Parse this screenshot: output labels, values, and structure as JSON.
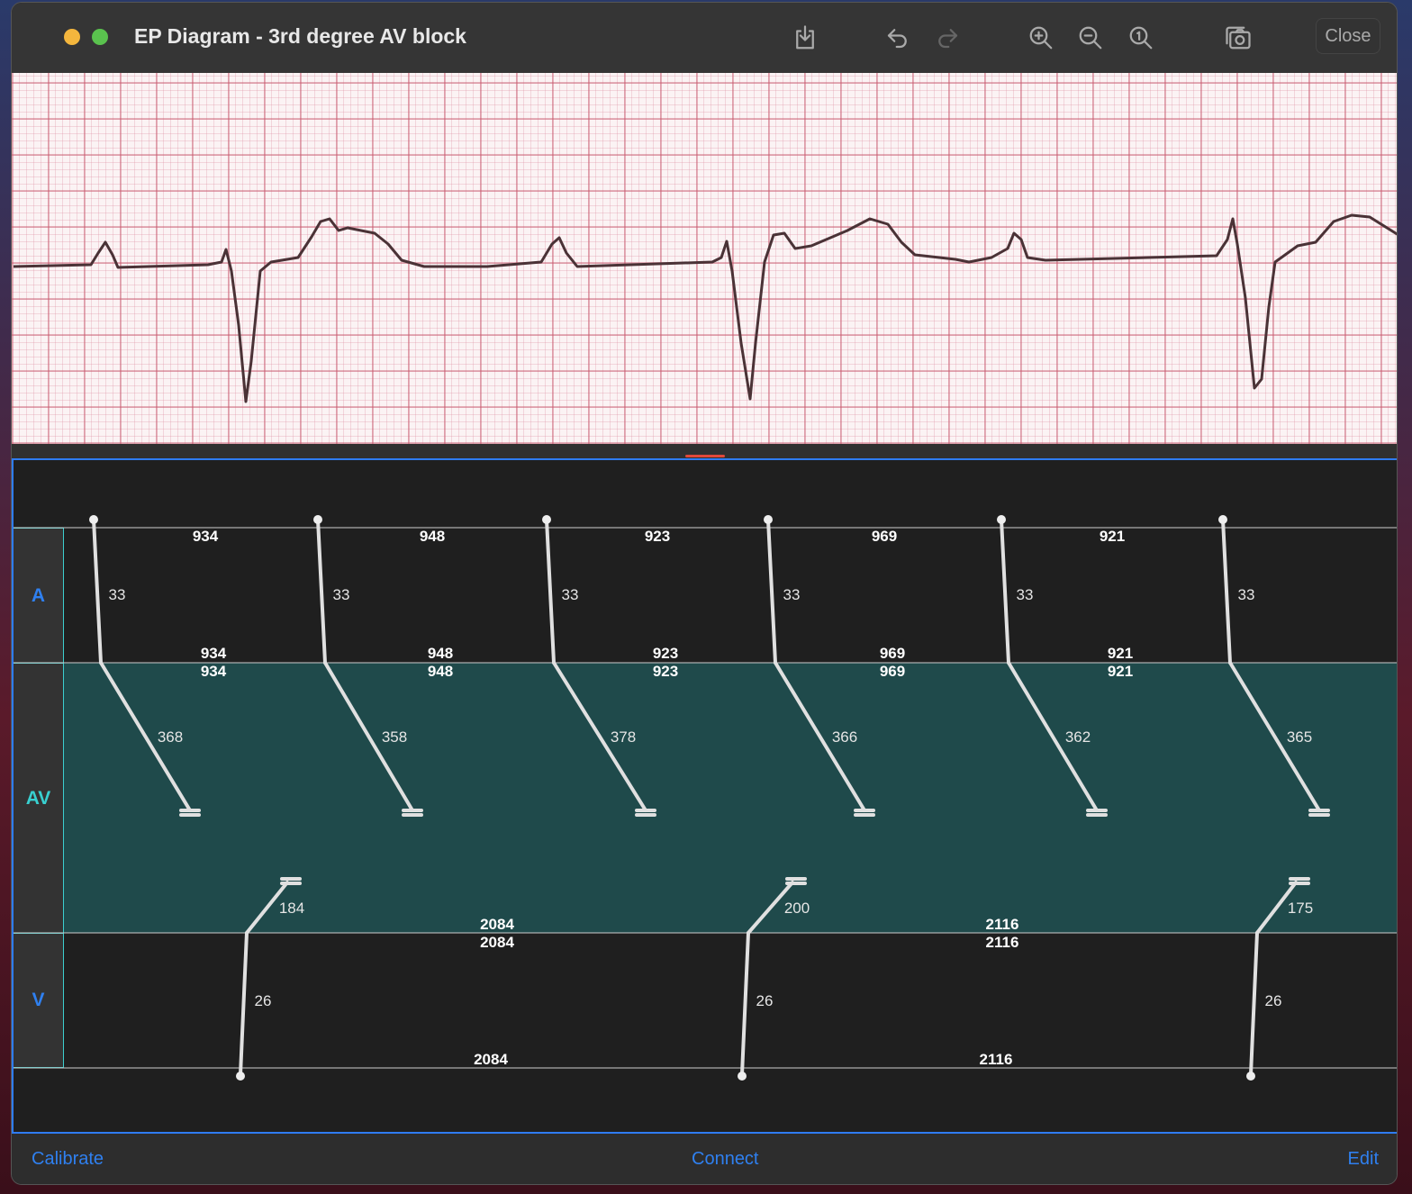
{
  "window": {
    "title": "EP Diagram - 3rd degree AV block",
    "close_label": "Close"
  },
  "toolbar": {
    "icons": [
      "share-icon",
      "undo-icon",
      "redo-icon",
      "zoom-in-icon",
      "zoom-out-icon",
      "zoom-reset-icon",
      "snapshot-icon"
    ]
  },
  "ladder": {
    "regions": [
      {
        "label": "A",
        "color": "#2f80f0"
      },
      {
        "label": "AV",
        "color": "#38d0d0"
      },
      {
        "label": "V",
        "color": "#2f80f0"
      }
    ],
    "a_cl_top": [
      "934",
      "948",
      "923",
      "969",
      "921"
    ],
    "a_cl_mid1": [
      "934",
      "948",
      "923",
      "969",
      "921"
    ],
    "a_cl_mid2": [
      "934",
      "948",
      "923",
      "969",
      "921"
    ],
    "a_cond": [
      "33",
      "33",
      "33",
      "33",
      "33",
      "33"
    ],
    "av_antegrade": [
      "368",
      "358",
      "378",
      "366",
      "362",
      "365"
    ],
    "av_retro": [
      "184",
      "200",
      "175"
    ],
    "v_cond": [
      "26",
      "26",
      "26"
    ],
    "v_cl_top1": [
      "2084",
      "2116"
    ],
    "v_cl_top2": [
      "2084",
      "2116"
    ],
    "v_cl_bottom": [
      "2084",
      "2116"
    ]
  },
  "bottom": {
    "calibrate": "Calibrate",
    "connect": "Connect",
    "edit": "Edit"
  }
}
